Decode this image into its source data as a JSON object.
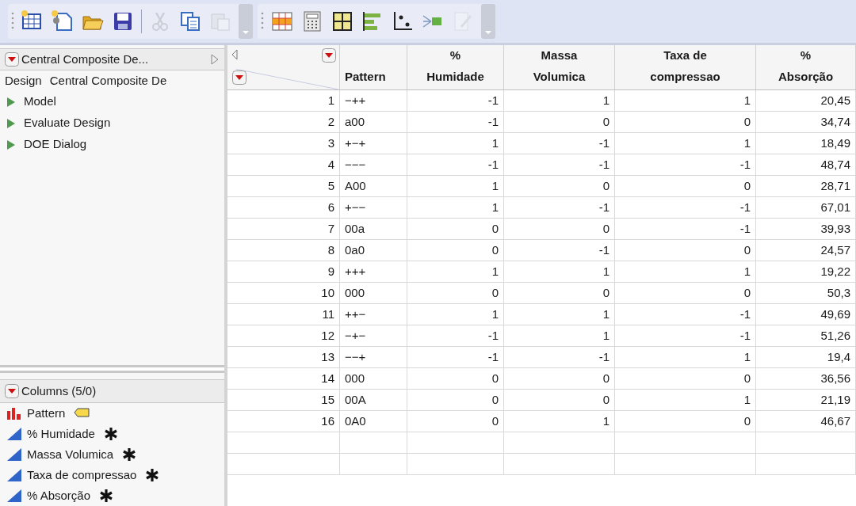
{
  "toolbar": {
    "groups": [
      {
        "items": [
          {
            "kind": "new-table",
            "disabled": false
          },
          {
            "kind": "new-script",
            "disabled": false
          },
          {
            "kind": "open",
            "disabled": false
          },
          {
            "kind": "save",
            "disabled": false
          },
          {
            "kind": "separator"
          },
          {
            "kind": "cut",
            "disabled": true
          },
          {
            "kind": "copy",
            "disabled": false
          },
          {
            "kind": "paste",
            "disabled": true
          }
        ]
      },
      {
        "items": [
          {
            "kind": "data-table",
            "disabled": false
          },
          {
            "kind": "calculator",
            "disabled": false
          },
          {
            "kind": "layout",
            "disabled": false
          },
          {
            "kind": "bars",
            "disabled": false
          },
          {
            "kind": "fit",
            "disabled": false
          },
          {
            "kind": "flow",
            "disabled": false
          },
          {
            "kind": "edit",
            "disabled": true
          }
        ]
      }
    ]
  },
  "table_panel": {
    "title": "Central Composite De...",
    "design_label": "Design",
    "design_value": "Central Composite De",
    "items": [
      {
        "label": "Model"
      },
      {
        "label": "Evaluate Design"
      },
      {
        "label": "DOE Dialog"
      }
    ]
  },
  "columns_panel": {
    "title": "Columns (5/0)",
    "columns": [
      {
        "name": "Pattern",
        "kind": "nominal",
        "labelled": true,
        "has_formula": false
      },
      {
        "name": "% Humidade",
        "kind": "continuous",
        "labelled": false,
        "has_formula": true
      },
      {
        "name": "Massa Volumica",
        "kind": "continuous",
        "labelled": false,
        "has_formula": true
      },
      {
        "name": "Taxa de compressao",
        "kind": "continuous",
        "labelled": false,
        "has_formula": true
      },
      {
        "name": "% Absorção",
        "kind": "continuous",
        "labelled": false,
        "has_formula": true
      }
    ]
  },
  "table": {
    "columns": [
      "Pattern",
      "%\nHumidade",
      "Massa\nVolumica",
      "Taxa de\ncompressao",
      "%\nAbsorção"
    ],
    "rows": [
      {
        "row": "1",
        "cells": [
          "−++",
          "-1",
          "1",
          "1",
          "20,45"
        ]
      },
      {
        "row": "2",
        "cells": [
          "a00",
          "-1",
          "0",
          "0",
          "34,74"
        ]
      },
      {
        "row": "3",
        "cells": [
          "+−+",
          "1",
          "-1",
          "1",
          "18,49"
        ]
      },
      {
        "row": "4",
        "cells": [
          "−−−",
          "-1",
          "-1",
          "-1",
          "48,74"
        ]
      },
      {
        "row": "5",
        "cells": [
          "A00",
          "1",
          "0",
          "0",
          "28,71"
        ]
      },
      {
        "row": "6",
        "cells": [
          "+−−",
          "1",
          "-1",
          "-1",
          "67,01"
        ]
      },
      {
        "row": "7",
        "cells": [
          "00a",
          "0",
          "0",
          "-1",
          "39,93"
        ]
      },
      {
        "row": "8",
        "cells": [
          "0a0",
          "0",
          "-1",
          "0",
          "24,57"
        ]
      },
      {
        "row": "9",
        "cells": [
          "+++",
          "1",
          "1",
          "1",
          "19,22"
        ]
      },
      {
        "row": "10",
        "cells": [
          "000",
          "0",
          "0",
          "0",
          "50,3"
        ]
      },
      {
        "row": "11",
        "cells": [
          "++−",
          "1",
          "1",
          "-1",
          "49,69"
        ]
      },
      {
        "row": "12",
        "cells": [
          "−+−",
          "-1",
          "1",
          "-1",
          "51,26"
        ]
      },
      {
        "row": "13",
        "cells": [
          "−−+",
          "-1",
          "-1",
          "1",
          "19,4"
        ]
      },
      {
        "row": "14",
        "cells": [
          "000",
          "0",
          "0",
          "0",
          "36,56"
        ]
      },
      {
        "row": "15",
        "cells": [
          "00A",
          "0",
          "0",
          "1",
          "21,19"
        ]
      },
      {
        "row": "16",
        "cells": [
          "0A0",
          "0",
          "1",
          "0",
          "46,67"
        ]
      }
    ]
  }
}
